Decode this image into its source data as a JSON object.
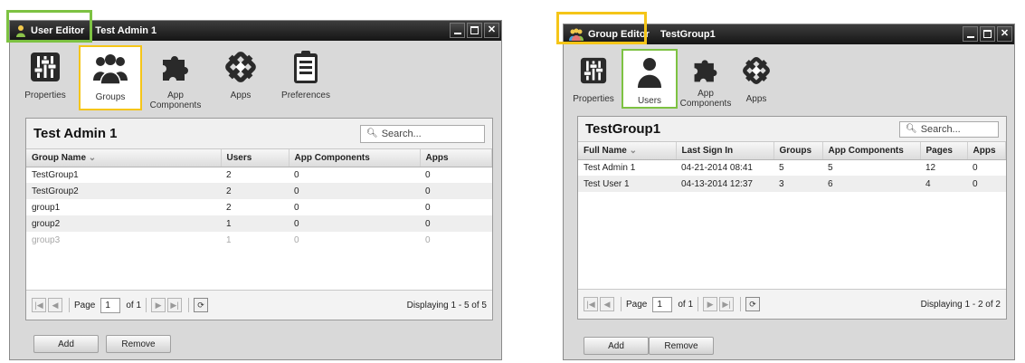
{
  "user_editor": {
    "title": "User Editor",
    "subtitle": "Test Admin 1",
    "tools": [
      {
        "label": "Properties",
        "icon": "sliders-icon"
      },
      {
        "label": "Groups",
        "icon": "group-icon"
      },
      {
        "label": "App\nComponents",
        "icon": "puzzle-icon"
      },
      {
        "label": "Apps",
        "icon": "apps-icon"
      },
      {
        "label": "Preferences",
        "icon": "clipboard-icon"
      }
    ],
    "panel_title": "Test Admin 1",
    "search_placeholder": "Search...",
    "columns": [
      "Group Name",
      "Users",
      "App Components",
      "Apps"
    ],
    "rows": [
      [
        "TestGroup1",
        "2",
        "0",
        "0"
      ],
      [
        "TestGroup2",
        "2",
        "0",
        "0"
      ],
      [
        "group1",
        "2",
        "0",
        "0"
      ],
      [
        "group2",
        "1",
        "0",
        "0"
      ],
      [
        "group3",
        "1",
        "0",
        "0"
      ]
    ],
    "pager": {
      "page_label": "Page",
      "page": "1",
      "of_label": "of 1",
      "status": "Displaying 1 - 5 of 5"
    },
    "add_label": "Add",
    "remove_label": "Remove"
  },
  "group_editor": {
    "title": "Group Editor",
    "subtitle": "TestGroup1",
    "tools": [
      {
        "label": "Properties",
        "icon": "sliders-icon"
      },
      {
        "label": "Users",
        "icon": "user-icon"
      },
      {
        "label": "App\nComponents",
        "icon": "puzzle-icon"
      },
      {
        "label": "Apps",
        "icon": "apps-icon"
      }
    ],
    "panel_title": "TestGroup1",
    "search_placeholder": "Search...",
    "columns": [
      "Full Name",
      "Last Sign In",
      "Groups",
      "App Components",
      "Pages",
      "Apps"
    ],
    "rows": [
      [
        "Test Admin 1",
        "04-21-2014 08:41",
        "5",
        "5",
        "12",
        "0"
      ],
      [
        "Test User 1",
        "04-13-2014 12:37",
        "3",
        "6",
        "4",
        "0"
      ]
    ],
    "pager": {
      "page_label": "Page",
      "page": "1",
      "of_label": "of 1",
      "status": "Displaying 1 - 2 of 2"
    },
    "add_label": "Add",
    "remove_label": "Remove"
  },
  "colors": {
    "highlight_green": "#7dc242",
    "highlight_yellow": "#f5c518",
    "titlebar": "#1f1f1f"
  }
}
